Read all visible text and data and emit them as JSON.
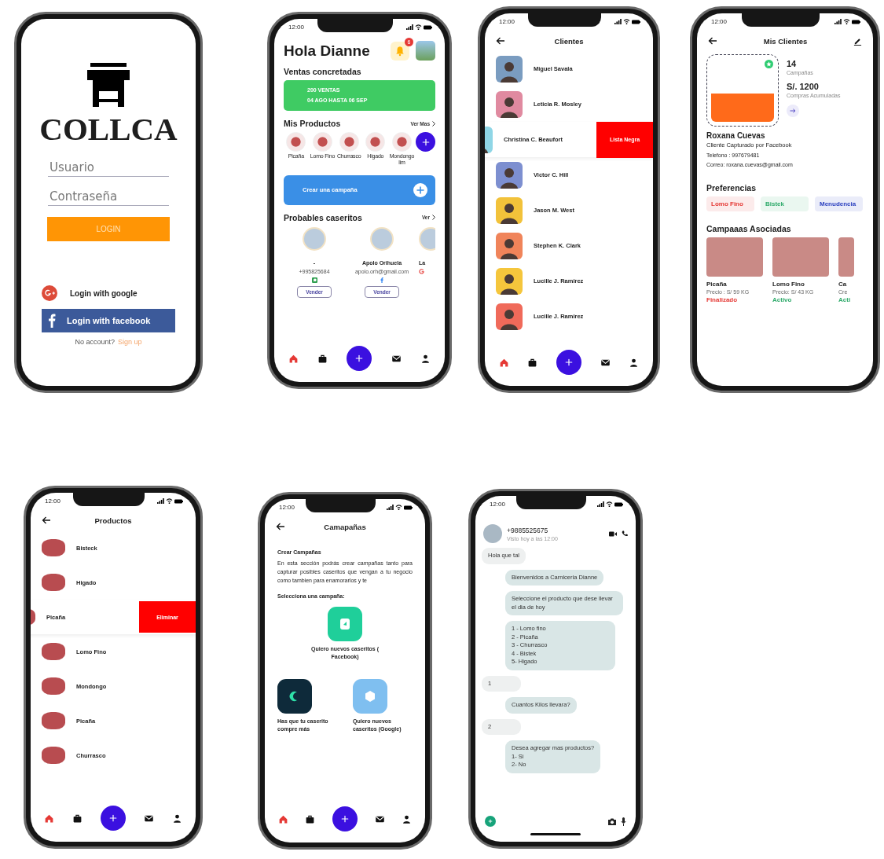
{
  "screens": [
    {
      "kind": "login",
      "logo": "COLLCA",
      "fields": [
        {
          "placeholder": "Usuario"
        },
        {
          "placeholder": "Contraseña"
        }
      ],
      "login_button": "LOGIN",
      "social_buttons": [
        {
          "kind": "google",
          "label": "Login with google"
        },
        {
          "kind": "facebook",
          "label": "Login with facebook"
        }
      ],
      "signup_prompt": "No account?",
      "signup_link": "Sign up"
    },
    {
      "kind": "home",
      "time": "12:00",
      "greeting": "Hola Dianne",
      "notification_count": "6",
      "sales": {
        "title": "Ventas concretadas",
        "lines": [
          "200 VENTAS",
          "04 AGO HASTA 06 SEP"
        ]
      },
      "products": {
        "title": "Mis Productos",
        "link": "Ver Mas",
        "items": [
          "Picaña",
          "Lomo Fino",
          "Churrasco",
          "Higado",
          "Mondongo lim"
        ]
      },
      "campaign_button": "Crear una campaña",
      "prospects": {
        "title": "Probables caseritos",
        "link": "Ver",
        "items": [
          {
            "name": "-",
            "contact": "+995825684",
            "kind": "whatsapp",
            "action": "Vender"
          },
          {
            "name": "Apolo Orihuela",
            "contact": "apolo.orh@gmail.com",
            "kind": "facebook",
            "action": "Vender"
          },
          {
            "name": "La",
            "kind": "google"
          }
        ]
      },
      "nav": [
        {
          "kind": "home",
          "selected": true
        },
        {
          "kind": "bag",
          "selected": false
        },
        {
          "kind": "add",
          "selected": false
        },
        {
          "kind": "mail",
          "selected": false
        },
        {
          "kind": "user",
          "selected": false
        }
      ]
    },
    {
      "kind": "clients",
      "time": "12:00",
      "title": "Clientes",
      "clients": [
        {
          "name": "Miguel Savala",
          "color": "#7a9cc0",
          "swiped": false
        },
        {
          "name": "Leticia R. Mosley",
          "color": "#e08aa0",
          "swiped": false
        },
        {
          "name": "Christina C. Beaufort",
          "color": "#8fd6e6",
          "swiped": true,
          "action": "Lista Negra"
        },
        {
          "name": "Victor C. Hill",
          "color": "#7d8fd0",
          "swiped": false
        },
        {
          "name": "Jason M. West",
          "color": "#f2c23a",
          "swiped": false
        },
        {
          "name": "Stephen K. Clark",
          "color": "#f0845a",
          "swiped": false
        },
        {
          "name": "Lucille J. Ramirez",
          "color": "#f5c63c",
          "swiped": false
        },
        {
          "name": "Lucille J. Ramirez",
          "color": "#f06a5a",
          "swiped": false
        }
      ],
      "nav": [
        {
          "kind": "home",
          "selected": true
        },
        {
          "kind": "bag",
          "selected": false
        },
        {
          "kind": "add",
          "selected": false
        },
        {
          "kind": "mail",
          "selected": false
        },
        {
          "kind": "user",
          "selected": false
        }
      ]
    },
    {
      "kind": "profile",
      "time": "12:00",
      "title": "Mis Clientes",
      "stats": [
        {
          "value": "14",
          "label": "Campañas"
        },
        {
          "value": "S/. 1200",
          "label": "Compras Acumuladas"
        }
      ],
      "name": "Roxana Cuevas",
      "subtitle": "Cliente Capturado por Facebook",
      "details": [
        "Telefono : 997679481",
        "Correo: roxana.cuevas@gmail.com"
      ],
      "preferences_title": "Preferencias",
      "preferences": [
        {
          "label": "Lomo Fino",
          "color": "#e53935"
        },
        {
          "label": "Bistek",
          "color": "#2eaa6a"
        },
        {
          "label": "Menudencia",
          "color": "#2a3fbf"
        }
      ],
      "campaigns_title": "Campaaas Asociadas",
      "campaigns": [
        {
          "name": "Picaña",
          "price": "Precio : S/ 59 KG",
          "status": "Finalizado",
          "color": "#e53935"
        },
        {
          "name": "Lomo Fino",
          "price": "Precio: S/ 43 KG",
          "status": "Activo",
          "color": "#2eaa6a"
        },
        {
          "name": "Ca",
          "price": "Cre",
          "status": "Acti",
          "color": "#2eaa6a"
        }
      ]
    },
    {
      "kind": "products",
      "time": "12:00",
      "title": "Productos",
      "products": [
        {
          "name": "Bisteck",
          "swiped": false
        },
        {
          "name": "Higado",
          "swiped": false
        },
        {
          "name": "Picaña",
          "swiped": true,
          "action": "Eliminar"
        },
        {
          "name": "Lomo Fino",
          "swiped": false
        },
        {
          "name": "Mondongo",
          "swiped": false
        },
        {
          "name": "Picaña",
          "swiped": false
        },
        {
          "name": "Churrasco",
          "swiped": false
        }
      ],
      "nav": [
        {
          "kind": "home",
          "selected": true
        },
        {
          "kind": "bag",
          "selected": false
        },
        {
          "kind": "add",
          "selected": false
        },
        {
          "kind": "mail",
          "selected": false
        },
        {
          "kind": "user",
          "selected": false
        }
      ]
    },
    {
      "kind": "campaigns",
      "time": "12:00",
      "title": "Camapañas",
      "section_title": "Crear Campañas",
      "description": "En esta sección podrás crear campañas tanto para capturar posibles caseritos que vengan a tu negocio como tambien para enamorarlos y te",
      "prompt": "Selecciona una campaña:",
      "options": [
        {
          "label": "Quiero nuevos caseritos ( Facebook)",
          "color": "#1fcf9a"
        },
        {
          "label": "Has que tu caserito compre más",
          "color": "#0e2a3a"
        },
        {
          "label": "Quiero nuevos caseritos (Google)",
          "color": "#7fbff0"
        }
      ],
      "nav": [
        {
          "kind": "home",
          "selected": true
        },
        {
          "kind": "bag",
          "selected": false
        },
        {
          "kind": "add",
          "selected": false
        },
        {
          "kind": "mail",
          "selected": false
        },
        {
          "kind": "user",
          "selected": false
        }
      ]
    },
    {
      "kind": "chat",
      "time": "12:00",
      "contact": "+9885525675",
      "status": "Visto hoy a las 12:00",
      "messages": [
        {
          "kind": "in",
          "text": "Hola que tal"
        },
        {
          "kind": "out",
          "text": "Bienvenidos a Carniceria Dianne"
        },
        {
          "kind": "out",
          "text": "Seleccione el producto que dese llevar el dia de hoy"
        },
        {
          "kind": "out",
          "text": "1 - Lomo fino\n2 - Picaña\n3 - Churrasco\n4 - Bistek\n5- Higado"
        },
        {
          "kind": "in",
          "text": "1"
        },
        {
          "kind": "out",
          "text": "Cuantos Kilos llevara?"
        },
        {
          "kind": "in",
          "text": "2"
        },
        {
          "kind": "out",
          "text": "Desea agregar mas productos?\n1- Si\n2- No"
        }
      ]
    }
  ]
}
